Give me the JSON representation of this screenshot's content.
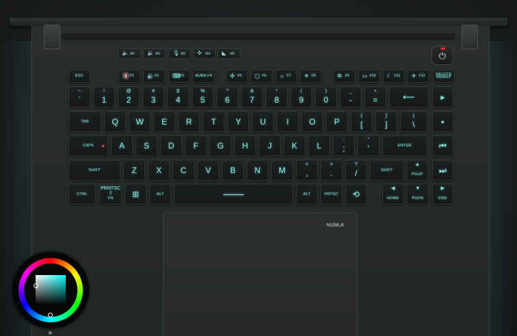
{
  "macro_keys": [
    {
      "label": "M1",
      "icon": "speaker-mute-icon",
      "glyph": "🔈"
    },
    {
      "label": "M2",
      "icon": "volume-down-icon",
      "glyph": "🔉"
    },
    {
      "label": "M3",
      "icon": "mic-mute-icon",
      "glyph": "🎙"
    },
    {
      "label": "M4",
      "icon": "fan-icon",
      "glyph": "✣"
    },
    {
      "label": "M5",
      "icon": "rog-logo-icon",
      "glyph": "◣"
    }
  ],
  "power": {
    "glyph": "⏻",
    "led_color": "#ff3030"
  },
  "function_row": [
    {
      "label": "ESC"
    },
    {
      "label": "F1",
      "glyph": "🔇"
    },
    {
      "label": "F2",
      "glyph": "🔉"
    },
    {
      "label": "F3",
      "glyph": "⌨"
    },
    {
      "label": "AURA F4"
    },
    {
      "label": "F5",
      "glyph": "✣"
    },
    {
      "label": "F6",
      "glyph": "▢"
    },
    {
      "label": "F7",
      "glyph": "☼"
    },
    {
      "label": "F8",
      "glyph": "☀"
    },
    {
      "label": "F9",
      "glyph": "⧉"
    },
    {
      "label": "F10",
      "glyph": "▭"
    },
    {
      "label": "F11",
      "glyph": "☾"
    },
    {
      "label": "F12",
      "glyph": "✈"
    },
    {
      "top": "DELETE",
      "bottom": "INSERT"
    }
  ],
  "number_row": [
    {
      "top": "~",
      "main": "`"
    },
    {
      "top": "!",
      "main": "1"
    },
    {
      "top": "@",
      "main": "2"
    },
    {
      "top": "#",
      "main": "3"
    },
    {
      "top": "$",
      "main": "4"
    },
    {
      "top": "%",
      "main": "5"
    },
    {
      "top": "^",
      "main": "6"
    },
    {
      "top": "&",
      "main": "7"
    },
    {
      "top": "*",
      "main": "8"
    },
    {
      "top": "(",
      "main": "9"
    },
    {
      "top": ")",
      "main": "0"
    },
    {
      "top": "_",
      "main": "-"
    },
    {
      "top": "+",
      "main": "="
    },
    {
      "main": "⟵"
    },
    {
      "main": "▸"
    }
  ],
  "qwerty_row": [
    {
      "label": "TAB"
    },
    {
      "main": "Q"
    },
    {
      "main": "W"
    },
    {
      "main": "E"
    },
    {
      "main": "R"
    },
    {
      "main": "T"
    },
    {
      "main": "Y"
    },
    {
      "main": "U"
    },
    {
      "main": "I"
    },
    {
      "main": "O"
    },
    {
      "main": "P"
    },
    {
      "top": "{",
      "main": "["
    },
    {
      "top": "}",
      "main": "]"
    },
    {
      "top": "|",
      "main": "\\"
    },
    {
      "main": "▪"
    }
  ],
  "home_row": [
    {
      "label": "CAPS"
    },
    {
      "main": "A"
    },
    {
      "main": "S"
    },
    {
      "main": "D"
    },
    {
      "main": "F"
    },
    {
      "main": "G"
    },
    {
      "main": "H"
    },
    {
      "main": "J"
    },
    {
      "main": "K"
    },
    {
      "main": "L"
    },
    {
      "top": ":",
      "main": ";"
    },
    {
      "top": "\"",
      "main": "'"
    },
    {
      "label": "ENTER"
    },
    {
      "main": "⏮"
    }
  ],
  "shift_row": [
    {
      "label": "SHIFT"
    },
    {
      "main": "Z"
    },
    {
      "main": "X"
    },
    {
      "main": "C"
    },
    {
      "main": "V"
    },
    {
      "main": "B"
    },
    {
      "main": "N"
    },
    {
      "main": "M"
    },
    {
      "top": "<",
      "main": ","
    },
    {
      "top": ">",
      "main": "."
    },
    {
      "top": "?",
      "main": "/"
    },
    {
      "label": "SHIFT"
    },
    {
      "top": "▲",
      "label": "PGUP"
    },
    {
      "main": "⏭"
    }
  ],
  "bottom_row": [
    {
      "label": "CTRL"
    },
    {
      "top": "PRNTSC ⇩",
      "label": "FN"
    },
    {
      "main": "⊞"
    },
    {
      "label": "ALT"
    },
    {
      "main": ""
    },
    {
      "label": "ALT"
    },
    {
      "label": "PRTSC"
    },
    {
      "main": "⟲"
    },
    {
      "top": "◀",
      "label": "HOME"
    },
    {
      "top": "▼",
      "label": "PGDN"
    },
    {
      "top": "▶",
      "label": "END"
    }
  ],
  "touchpad": {
    "label": "NUMLK"
  },
  "colors": {
    "backlight": "#8fe8e0",
    "caps_led": "#ff3b3b"
  }
}
